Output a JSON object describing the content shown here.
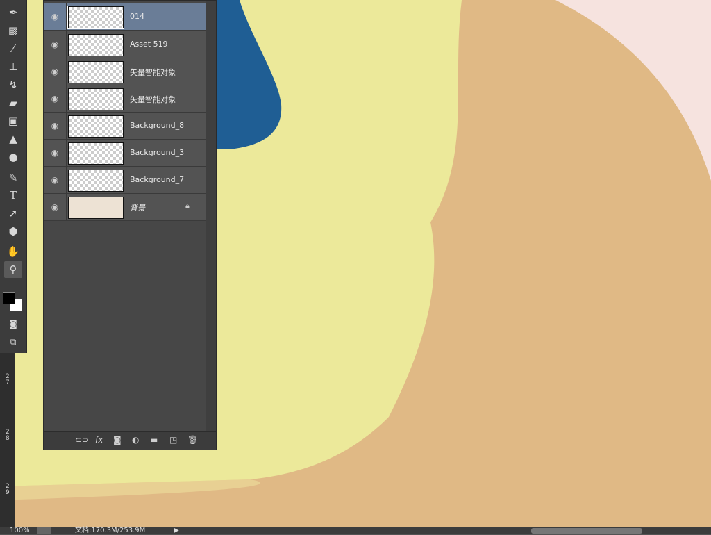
{
  "toolbar": {
    "tools": [
      "eyedropper-icon",
      "marquee-icon",
      "brush-icon",
      "stamp-icon",
      "history-brush-icon",
      "eraser-icon",
      "gradient-icon",
      "sharpen-icon",
      "dodge-icon",
      "pen-icon",
      "type-icon",
      "path-select-icon",
      "shape-icon",
      "hand-icon",
      "zoom-icon"
    ],
    "type_glyph": "T"
  },
  "ruler": {
    "labels": [
      "2\n7",
      "2\n8",
      "2\n9"
    ]
  },
  "layers": [
    {
      "name": "014",
      "visible": true,
      "selected": true
    },
    {
      "name": "Asset 519",
      "visible": true
    },
    {
      "name": "矢量智能对象",
      "visible": true
    },
    {
      "name": "矢量智能对象",
      "visible": true
    },
    {
      "name": "Background_8",
      "visible": true
    },
    {
      "name": "Background_3",
      "visible": true
    },
    {
      "name": "Background_7",
      "visible": true
    },
    {
      "name": "背景",
      "visible": true,
      "locked": true
    }
  ],
  "layers_footer": {
    "fx": "fx"
  },
  "status": {
    "zoom": "100%",
    "doc": "文档:170.3M/253.9M"
  },
  "colors": {
    "yellow": "#ecea9a",
    "tan": "#e4bd8a",
    "blue": "#1f5e94",
    "pink": "#f6e3df",
    "selection": "#6a7d97"
  }
}
